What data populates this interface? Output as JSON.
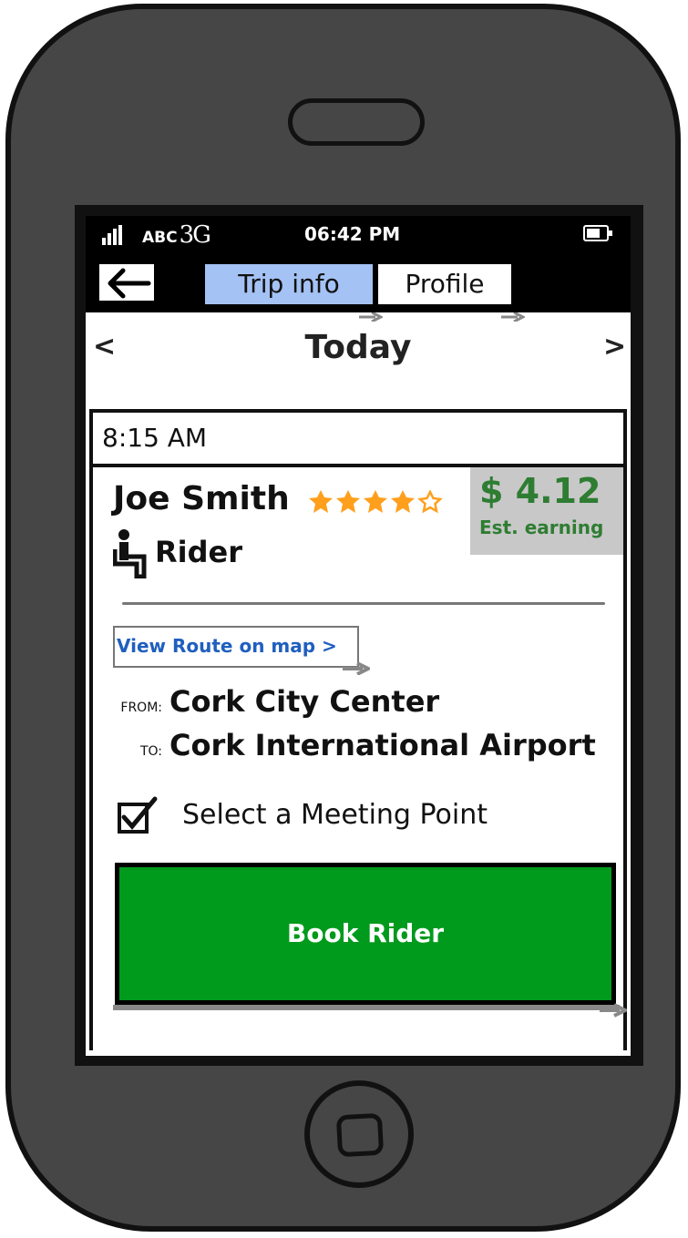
{
  "status_bar": {
    "carrier": "ABC",
    "network": "3G",
    "time": "06:42 PM"
  },
  "nav": {
    "tabs": [
      {
        "label": "Trip info",
        "selected": true
      },
      {
        "label": "Profile",
        "selected": false
      }
    ]
  },
  "date_nav": {
    "prev": "<",
    "title": "Today",
    "next": ">"
  },
  "trip": {
    "time": "8:15 AM",
    "rider_name": "Joe Smith",
    "rating": 4,
    "rating_max": 5,
    "role": "Rider",
    "earning_amount": "$ 4.12",
    "earning_label": "Est. earning",
    "map_link": "View Route on map >",
    "from_label": "FROM:",
    "from": "Cork City Center",
    "to_label": "TO:",
    "to": "Cork International Airport",
    "meeting_point_label": "Select a Meeting Point",
    "meeting_point_checked": true,
    "book_button": "Book Rider"
  },
  "colors": {
    "tab_selected": "#a4c2f4",
    "earning_text": "#2e7d32",
    "book_button": "#009a1c",
    "star": "#ff9f1c"
  },
  "icons": {
    "back": "back-arrow-icon",
    "role": "seated-person-icon",
    "checkbox": "checkbox-checked-icon"
  }
}
